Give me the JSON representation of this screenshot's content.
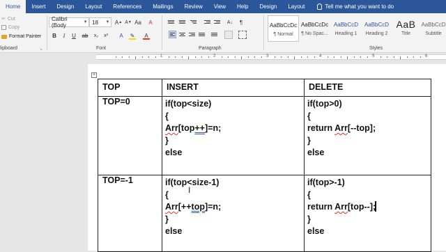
{
  "tabs": [
    "Home",
    "Insert",
    "Design",
    "Layout",
    "References",
    "Mailings",
    "Review",
    "View",
    "Help",
    "Design",
    "Layout"
  ],
  "tell_me": "Tell me what you want to do",
  "clipboard": {
    "cut": "Cut",
    "copy": "Copy",
    "format_painter": "Format Painter",
    "label": "lipboard"
  },
  "font": {
    "name": "Calibri (Body",
    "size": "18",
    "label": "Font"
  },
  "paragraph": {
    "label": "Paragraph"
  },
  "styles": {
    "label": "Styles",
    "items": [
      {
        "sample": "AaBbCcDc",
        "name": "¶ Normal"
      },
      {
        "sample": "AaBbCcDc",
        "name": "¶ No Spac..."
      },
      {
        "sample": "AaBbCcD",
        "name": "Heading 1"
      },
      {
        "sample": "AaBbCcD",
        "name": "Heading 2"
      },
      {
        "sample": "AaB",
        "name": "Title"
      },
      {
        "sample": "AaBbCcD",
        "name": "Subtitle"
      }
    ]
  },
  "ruler_numbers": [
    "1",
    "2",
    "3",
    "4",
    "5",
    "6"
  ],
  "table": {
    "headers": [
      "TOP",
      "INSERT",
      "DELETE"
    ],
    "row1": {
      "label": "TOP=0",
      "insert": {
        "l1": "if(top<size)",
        "l2": "{",
        "l3a": "Arr",
        "l3b": "[top",
        "l3c": "++",
        "l3d": "]=n;",
        "l4": "}",
        "l5": "else"
      },
      "delete": {
        "l1": "if(top>0)",
        "l2": "{",
        "l3a": "return ",
        "l3b": "Arr",
        "l3c": "[--top];",
        "l4": "}",
        "l5": "else"
      }
    },
    "row2": {
      "label": "TOP=-1",
      "insert": {
        "l1": "if(top<size-1)",
        "l2": "{",
        "l3a": "Arr",
        "l3b": "[++",
        "l3c": "top",
        "l3d": "]=n;",
        "l4": "}",
        "l5": "else"
      },
      "delete": {
        "l1": "if(top>-1)",
        "l2": "{",
        "l3a": "return ",
        "l3b": "Arr",
        "l3c": "[top--",
        "l3d": "];",
        "l4": "}",
        "l5": "else"
      }
    }
  },
  "colors": {
    "ribbon_blue": "#2b579a",
    "highlight": "#ffd800",
    "font_color": "#e03b24"
  }
}
